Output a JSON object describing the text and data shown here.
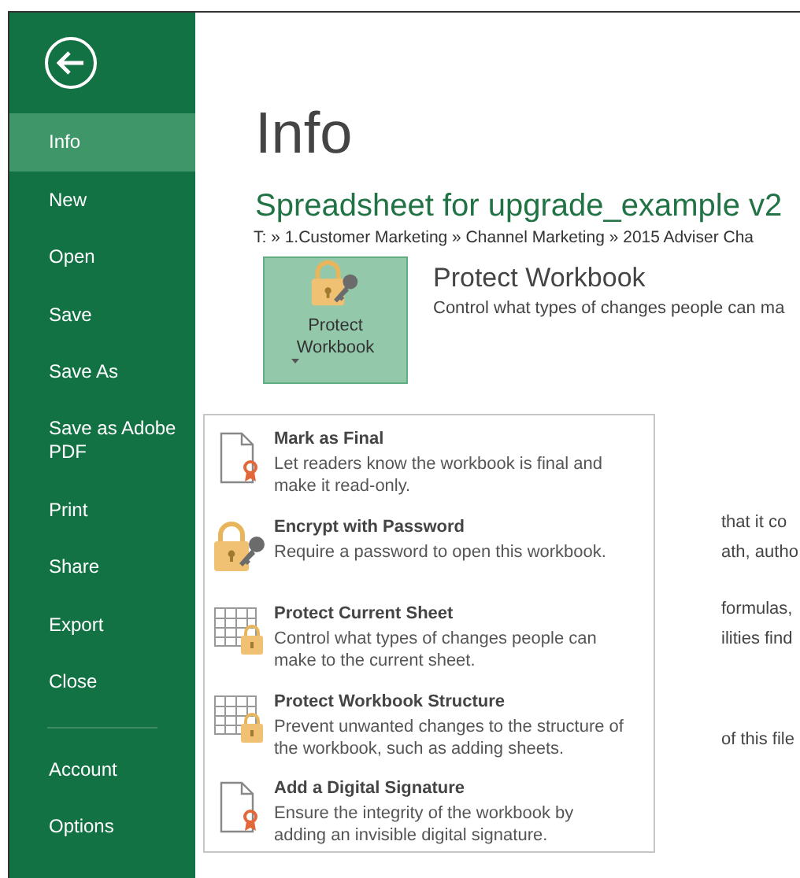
{
  "sidebar": {
    "items": [
      {
        "label": "Info",
        "selected": true
      },
      {
        "label": "New",
        "selected": false
      },
      {
        "label": "Open",
        "selected": false
      },
      {
        "label": "Save",
        "selected": false
      },
      {
        "label": "Save As",
        "selected": false
      },
      {
        "label": "Save as Adobe PDF",
        "selected": false
      },
      {
        "label": "Print",
        "selected": false
      },
      {
        "label": "Share",
        "selected": false
      },
      {
        "label": "Export",
        "selected": false
      },
      {
        "label": "Close",
        "selected": false
      }
    ],
    "footer_items": [
      {
        "label": "Account",
        "selected": false
      },
      {
        "label": "Options",
        "selected": false
      }
    ]
  },
  "page": {
    "heading": "Info",
    "title": "Spreadsheet for upgrade_example v2",
    "path": "T: » 1.Customer Marketing » Channel Marketing » 2015 Adviser Cha"
  },
  "protect": {
    "button_label": "Protect Workbook",
    "heading": "Protect Workbook",
    "description": "Control what types of changes people can ma"
  },
  "background_text": [
    "that it co",
    "ath, autho",
    "formulas,",
    "ilities find",
    "of this file"
  ],
  "menu": {
    "items": [
      {
        "kind": "document",
        "title": "Mark as Final",
        "description": "Let readers know the workbook is final and make it read-only."
      },
      {
        "kind": "lock",
        "title": "Encrypt with Password",
        "description": "Require a password to open this workbook."
      },
      {
        "kind": "sheet",
        "title": "Protect Current Sheet",
        "description": "Control what types of changes people can make to the current sheet."
      },
      {
        "kind": "sheet",
        "title": "Protect Workbook Structure",
        "description": "Prevent unwanted changes to the structure of the workbook, such as adding sheets."
      },
      {
        "kind": "document",
        "title": "Add a Digital Signature",
        "description": "Ensure the integrity of the workbook by adding an invisible digital signature."
      }
    ]
  }
}
